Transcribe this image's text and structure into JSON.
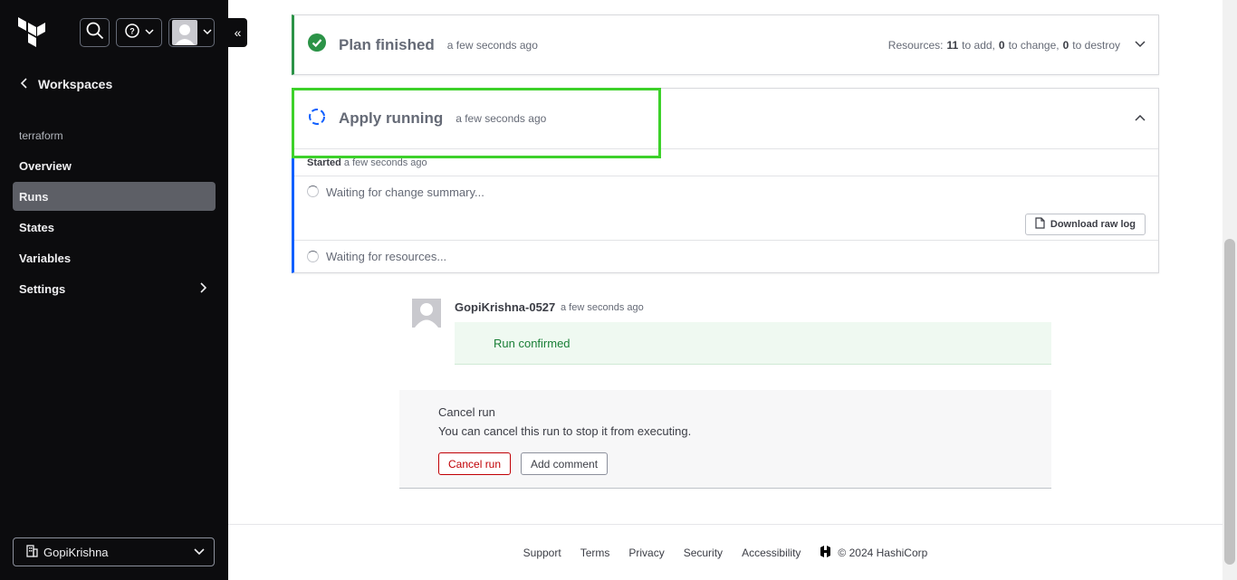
{
  "sidebar": {
    "back_label": "Workspaces",
    "workspace_name": "terraform",
    "nav": [
      {
        "label": "Overview"
      },
      {
        "label": "Runs"
      },
      {
        "label": "States"
      },
      {
        "label": "Variables"
      },
      {
        "label": "Settings"
      }
    ],
    "org_label": "GopiKrishna",
    "collapse_glyph": "«"
  },
  "plan": {
    "title": "Plan finished",
    "time": "a few seconds ago",
    "resources_prefix": "Resources:",
    "add_count": "11",
    "add_text": "to add,",
    "change_count": "0",
    "change_text": "to change,",
    "destroy_count": "0",
    "destroy_text": "to destroy"
  },
  "apply": {
    "title": "Apply running",
    "time": "a few seconds ago",
    "started_label": "Started",
    "started_time": "a few seconds ago",
    "wait_summary": "Waiting for change summary...",
    "download_label": "Download raw log",
    "wait_resources": "Waiting for resources..."
  },
  "comment": {
    "user": "GopiKrishna-0527",
    "time": "a few seconds ago",
    "message": "Run confirmed"
  },
  "cancel": {
    "title": "Cancel run",
    "description": "You can cancel this run to stop it from executing.",
    "cancel_button": "Cancel run",
    "comment_button": "Add comment"
  },
  "footer": {
    "links": [
      "Support",
      "Terms",
      "Privacy",
      "Security",
      "Accessibility"
    ],
    "copyright": "© 2024 HashiCorp"
  },
  "colors": {
    "sidebar_bg": "#0c0c0e",
    "success": "#2b9347",
    "running": "#1060ff",
    "danger": "#c00005",
    "highlight": "#3dd12a"
  }
}
